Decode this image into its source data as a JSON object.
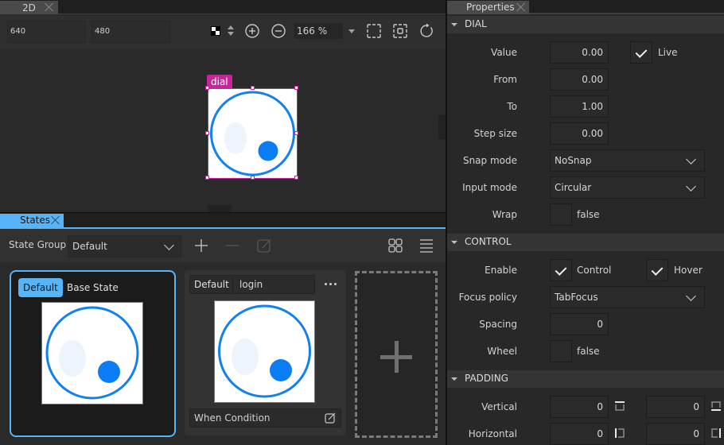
{
  "editor2d": {
    "tab_label": "2D",
    "width_value": "640",
    "height_value": "480",
    "zoom_value": "166 %",
    "selection_label": "dial",
    "icons": [
      "checkerboard-icon",
      "up-down-icon",
      "zoom-in-icon",
      "zoom-out-icon",
      "zoom-dropdown-icon",
      "fit-selection-icon",
      "fit-all-icon",
      "reset-view-icon"
    ]
  },
  "states": {
    "tab_label": "States",
    "state_group_label": "State Group",
    "state_group_value": "Default",
    "cards": [
      {
        "badge": "Default",
        "name": "Base State",
        "active": true
      },
      {
        "badge": "Default",
        "name": "login",
        "condition_label": "When Condition",
        "active": false
      }
    ]
  },
  "properties": {
    "tab_label": "Properties",
    "sections": {
      "dial": {
        "title": "DIAL",
        "value_label": "Value",
        "value": "0.00",
        "live_label": "Live",
        "live_checked": true,
        "from_label": "From",
        "from": "0.00",
        "to_label": "To",
        "to": "1.00",
        "step_label": "Step size",
        "step": "0.00",
        "snap_label": "Snap mode",
        "snap": "NoSnap",
        "input_label": "Input mode",
        "input": "Circular",
        "wrap_label": "Wrap",
        "wrap": "false",
        "wrap_checked": false
      },
      "control": {
        "title": "CONTROL",
        "enable_label": "Enable",
        "control_label": "Control",
        "control_checked": true,
        "hover_label": "Hover",
        "hover_checked": true,
        "focus_label": "Focus policy",
        "focus": "TabFocus",
        "spacing_label": "Spacing",
        "spacing": "0",
        "wheel_label": "Wheel",
        "wheel": "false",
        "wheel_checked": false
      },
      "padding": {
        "title": "PADDING",
        "vertical_label": "Vertical",
        "top": "0",
        "bottom": "0",
        "horizontal_label": "Horizontal",
        "left": "0",
        "right": "0"
      }
    }
  },
  "colors": {
    "accent": "#56b4f7",
    "selection": "#c5279a",
    "dial_blue": "#0a7cf5"
  }
}
